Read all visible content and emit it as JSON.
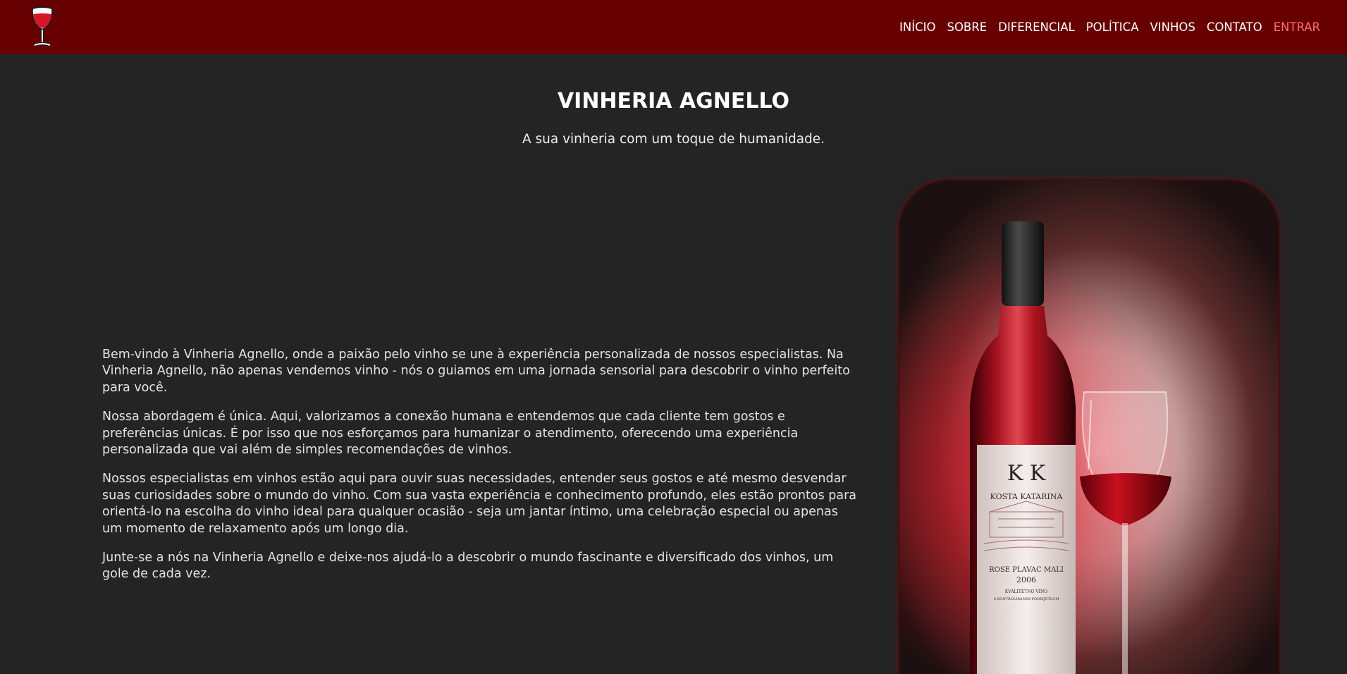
{
  "header": {
    "logo_icon": "wine-glass-icon",
    "nav": [
      {
        "label": "INÍCIO"
      },
      {
        "label": "SOBRE"
      },
      {
        "label": "DIFERENCIAL"
      },
      {
        "label": "POLÍTICA"
      },
      {
        "label": "VINHOS"
      },
      {
        "label": "CONTATO"
      },
      {
        "label": "ENTRAR"
      }
    ]
  },
  "hero": {
    "title": "VINHERIA AGNELLO",
    "subtitle": "A sua vinheria com um toque de humanidade."
  },
  "about": {
    "paragraphs": [
      "Bem-vindo à Vinheria Agnello, onde a paixão pelo vinho se une à experiência personalizada de nossos especialistas. Na Vinheria Agnello, não apenas vendemos vinho - nós o guiamos em uma jornada sensorial para descobrir o vinho perfeito para você.",
      "Nossa abordagem é única. Aqui, valorizamos a conexão humana e entendemos que cada cliente tem gostos e preferências únicas. É por isso que nos esforçamos para humanizar o atendimento, oferecendo uma experiência personalizada que vai além de simples recomendações de vinhos.",
      "Nossos especialistas em vinhos estão aqui para ouvir suas necessidades, entender seus gostos e até mesmo desvendar suas curiosidades sobre o mundo do vinho. Com sua vasta experiência e conhecimento profundo, eles estão prontos para orientá-lo na escolha do vinho ideal para qualquer ocasião - seja um jantar íntimo, uma celebração especial ou apenas um momento de relaxamento após um longo dia.",
      "Junte-se a nós na Vinheria Agnello e deixe-nos ajudá-lo a descobrir o mundo fascinante e diversificado dos vinhos, um gole de cada vez."
    ]
  },
  "image": {
    "label_brand": "K  K",
    "label_winery": "KOSTA KATARINA",
    "label_variety": "ROSE PLAVAC MALI",
    "label_year": "2006",
    "label_line1": "KVALITETNO VINO",
    "label_line2": "S KONTROLIRANIM PODRIJETLOM"
  },
  "colors": {
    "navbar": "#660000",
    "page_background": "#242424",
    "accent_link": "#ff6b6b"
  }
}
